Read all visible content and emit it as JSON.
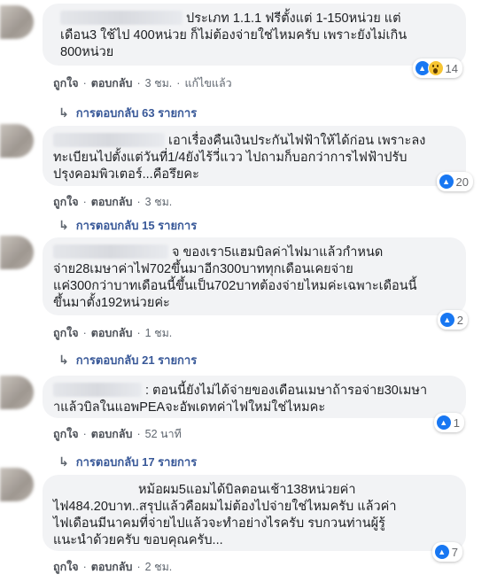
{
  "comments": [
    {
      "lines": [
        "ประเภท 1.1.1 ฟรีตั้งแต่ 1-150หน่วย แต่",
        "เดือน3 ใช้ไป 400หน่วย ก็ไม่ต้องจ่ายใช่ไหมครับ เพราะยังไม่เกิน",
        "800หน่วย"
      ],
      "reaction_count": "14",
      "like": "ถูกใจ",
      "reply": "ตอบกลับ",
      "time": "3 ชม.",
      "edited": "แก้ไขแล้ว",
      "replies_label": "การตอบกลับ 63 รายการ"
    },
    {
      "lines": [
        "เอาเรื่องคืนเงินประกันไฟฟ้าให้ได้ก่อน เพราะลง",
        "ทะเบียนไปตั้งแต่วันที่1/4ยังไร้วี่แวว ไปถามก็บอกว่าการไฟฟ้าปรับ",
        "ปรุงคอมพิวเตอร์...คือรึยคะ"
      ],
      "reaction_count": "20",
      "like": "ถูกใจ",
      "reply": "ตอบกลับ",
      "time": "3 ชม.",
      "replies_label": "การตอบกลับ 15 รายการ"
    },
    {
      "lines": [
        "จ ของเรา5แฮมบิลค่าไฟมาแล้วกำหนด",
        "จ่าย28เมษาค่าไฟ702ขึ้นมาอีก300บาททุกเดือนเคยจ่าย",
        "แค่300กว่าบาทเดือนนี้ขึ้นเป็น702บาทต้องจ่ายไหมค่ะเฉพาะเดือนนี้",
        "ขึ้นมาตั้ง192หน่วยค่ะ"
      ],
      "reaction_count": "2",
      "like": "ถูกใจ",
      "reply": "ตอบกลับ",
      "time": "1 ชม.",
      "replies_label": "การตอบกลับ 21 รายการ"
    },
    {
      "lines": ": ตอนนี้ยังไม่ได้จ่ายของเดือนเมษาถ้ารอจ่าย30เมษา|าแล้วบิลในแอพPEAจะอัพเดทค่าไฟใหม่ใช่ไหมคะ",
      "reaction_count": "1",
      "like": "ถูกใจ",
      "reply": "ตอบกลับ",
      "time": "52 นาที",
      "replies_label": "การตอบกลับ 17 รายการ"
    },
    {
      "lines": [
        "หม้อผม5แอมได้บิลตอนเช้า138หน่วยค่า",
        "ไฟ484.20บาท..สรุปแล้วคือผมไม่ต้องไปจ่ายใช่ไหมครับ แล้วค่า",
        "ไฟเดือนมีนาคมที่จ่ายไปแล้วจะทำอย่างไรครับ รบกวนท่านผู้รู้",
        "แนะนำด้วยครับ ขอบคุณครับ..."
      ],
      "reaction_count": "7",
      "like": "ถูกใจ",
      "reply": "ตอบกลับ",
      "time": "2 ชม."
    }
  ],
  "colors": {
    "bubble": "#f2f3f5",
    "link": "#385898",
    "like_blue": "#1877f2",
    "meta": "#606770"
  },
  "icons": {
    "like": "thumbs-up-icon",
    "wow": "wow-face-icon",
    "reply_arrow": "reply-arrow-icon"
  }
}
